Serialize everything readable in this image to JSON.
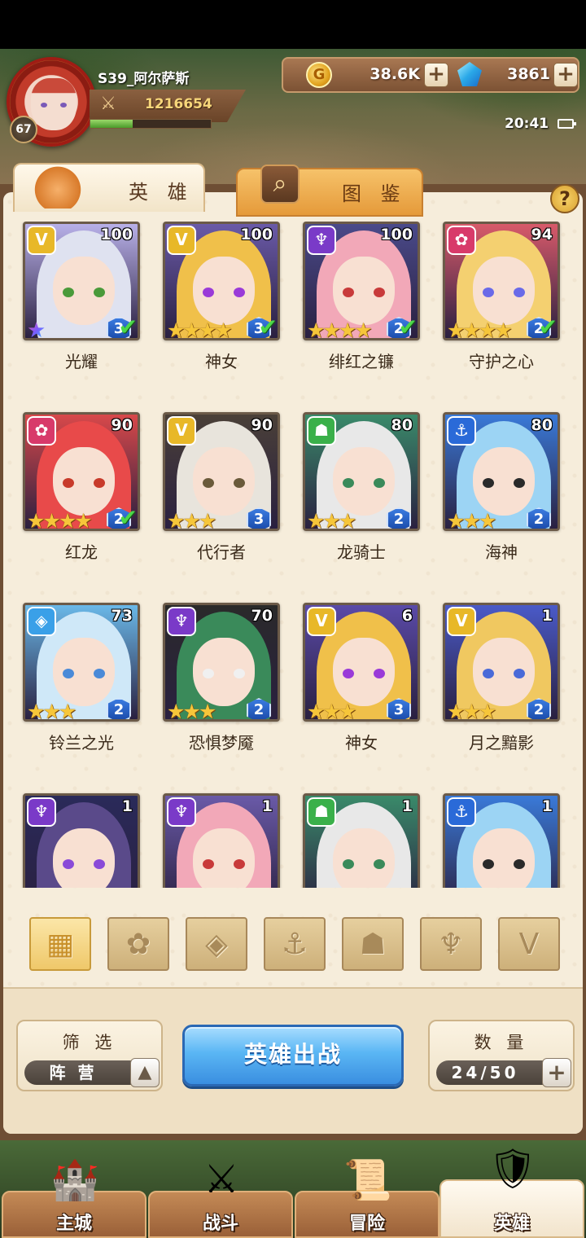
{
  "player": {
    "name": "S39_阿尔萨斯",
    "level": "67",
    "power": "1216654",
    "xp_fraction": 0.35
  },
  "currency": {
    "gold": "38.6K",
    "gems": "3861"
  },
  "status": {
    "time": "20:41"
  },
  "tabs": {
    "heroes": "英 雄",
    "codex": "图 鉴"
  },
  "help_label": "?",
  "heroes": [
    {
      "name": "光耀",
      "level": "100",
      "faction": "light",
      "stars": "rainbow",
      "rank": "3",
      "equipped": true
    },
    {
      "name": "神女",
      "level": "100",
      "faction": "light",
      "stars": 4,
      "rank": "3",
      "equipped": true
    },
    {
      "name": "绯红之镰",
      "level": "100",
      "faction": "dark",
      "stars": 4,
      "rank": "2",
      "equipped": true
    },
    {
      "name": "守护之心",
      "level": "94",
      "faction": "fire",
      "stars": 4,
      "rank": "2",
      "equipped": true
    },
    {
      "name": "红龙",
      "level": "90",
      "faction": "fire",
      "stars": 4,
      "rank": "2",
      "equipped": true
    },
    {
      "name": "代行者",
      "level": "90",
      "faction": "light",
      "stars": 3,
      "rank": "3",
      "equipped": false
    },
    {
      "name": "龙骑士",
      "level": "80",
      "faction": "beast",
      "stars": 3,
      "rank": "2",
      "equipped": false
    },
    {
      "name": "海神",
      "level": "80",
      "faction": "water",
      "stars": 3,
      "rank": "2",
      "equipped": false
    },
    {
      "name": "铃兰之光",
      "level": "73",
      "faction": "ice",
      "stars": 3,
      "rank": "2",
      "equipped": false
    },
    {
      "name": "恐惧梦魇",
      "level": "70",
      "faction": "dark",
      "stars": 3,
      "rank": "2",
      "equipped": false
    },
    {
      "name": "神女",
      "level": "6",
      "faction": "light",
      "stars": 3,
      "rank": "3",
      "equipped": false
    },
    {
      "name": "月之黯影",
      "level": "1",
      "faction": "light",
      "stars": 3,
      "rank": "2",
      "equipped": false
    },
    {
      "name": "",
      "level": "1",
      "faction": "dark",
      "stars": 0,
      "rank": "",
      "equipped": false
    },
    {
      "name": "",
      "level": "1",
      "faction": "dark",
      "stars": 0,
      "rank": "",
      "equipped": false
    },
    {
      "name": "",
      "level": "1",
      "faction": "beast",
      "stars": 0,
      "rank": "",
      "equipped": false
    },
    {
      "name": "",
      "level": "1",
      "faction": "water",
      "stars": 0,
      "rank": "",
      "equipped": false
    }
  ],
  "faction_filters": [
    {
      "name": "all-factions",
      "active": true
    },
    {
      "name": "fire-faction",
      "active": false
    },
    {
      "name": "ice-faction",
      "active": false
    },
    {
      "name": "water-faction",
      "active": false
    },
    {
      "name": "beast-faction",
      "active": false
    },
    {
      "name": "dark-faction",
      "active": false
    },
    {
      "name": "light-faction",
      "active": false
    }
  ],
  "filter_box": {
    "title": "筛 选",
    "value": "阵 营"
  },
  "deploy_label": "英雄出战",
  "count_box": {
    "title": "数 量",
    "value": "24/50"
  },
  "nav": [
    {
      "label": "主城",
      "active": false
    },
    {
      "label": "战斗",
      "active": false
    },
    {
      "label": "冒险",
      "active": false
    },
    {
      "label": "英雄",
      "active": true
    }
  ],
  "colors": {
    "light": "#e8b828",
    "dark": "#7a3ac8",
    "fire": "#d83a6a",
    "beast": "#3ab04a",
    "water": "#2a6ad8",
    "ice": "#3aa0e8",
    "deploy": "#5ab6f4"
  }
}
